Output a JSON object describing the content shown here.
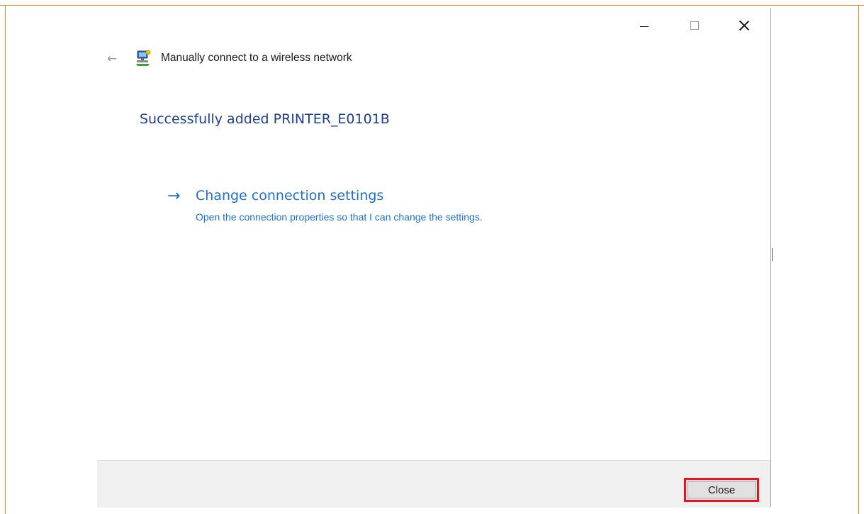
{
  "window": {
    "title": "Manually connect to a wireless network",
    "caption_buttons": {
      "minimize": "minimize-icon",
      "maximize": "maximize-icon",
      "close": "close-icon"
    }
  },
  "content": {
    "heading": "Successfully added PRINTER_E0101B",
    "link": {
      "arrow": "→",
      "title": "Change connection settings",
      "description": "Open the connection properties so that I can change the settings."
    }
  },
  "footer": {
    "close_label": "Close"
  },
  "colors": {
    "heading": "#1e3f8a",
    "link": "#1f6fc4",
    "highlight": "#e8141c",
    "frame": "#d98a2b"
  }
}
